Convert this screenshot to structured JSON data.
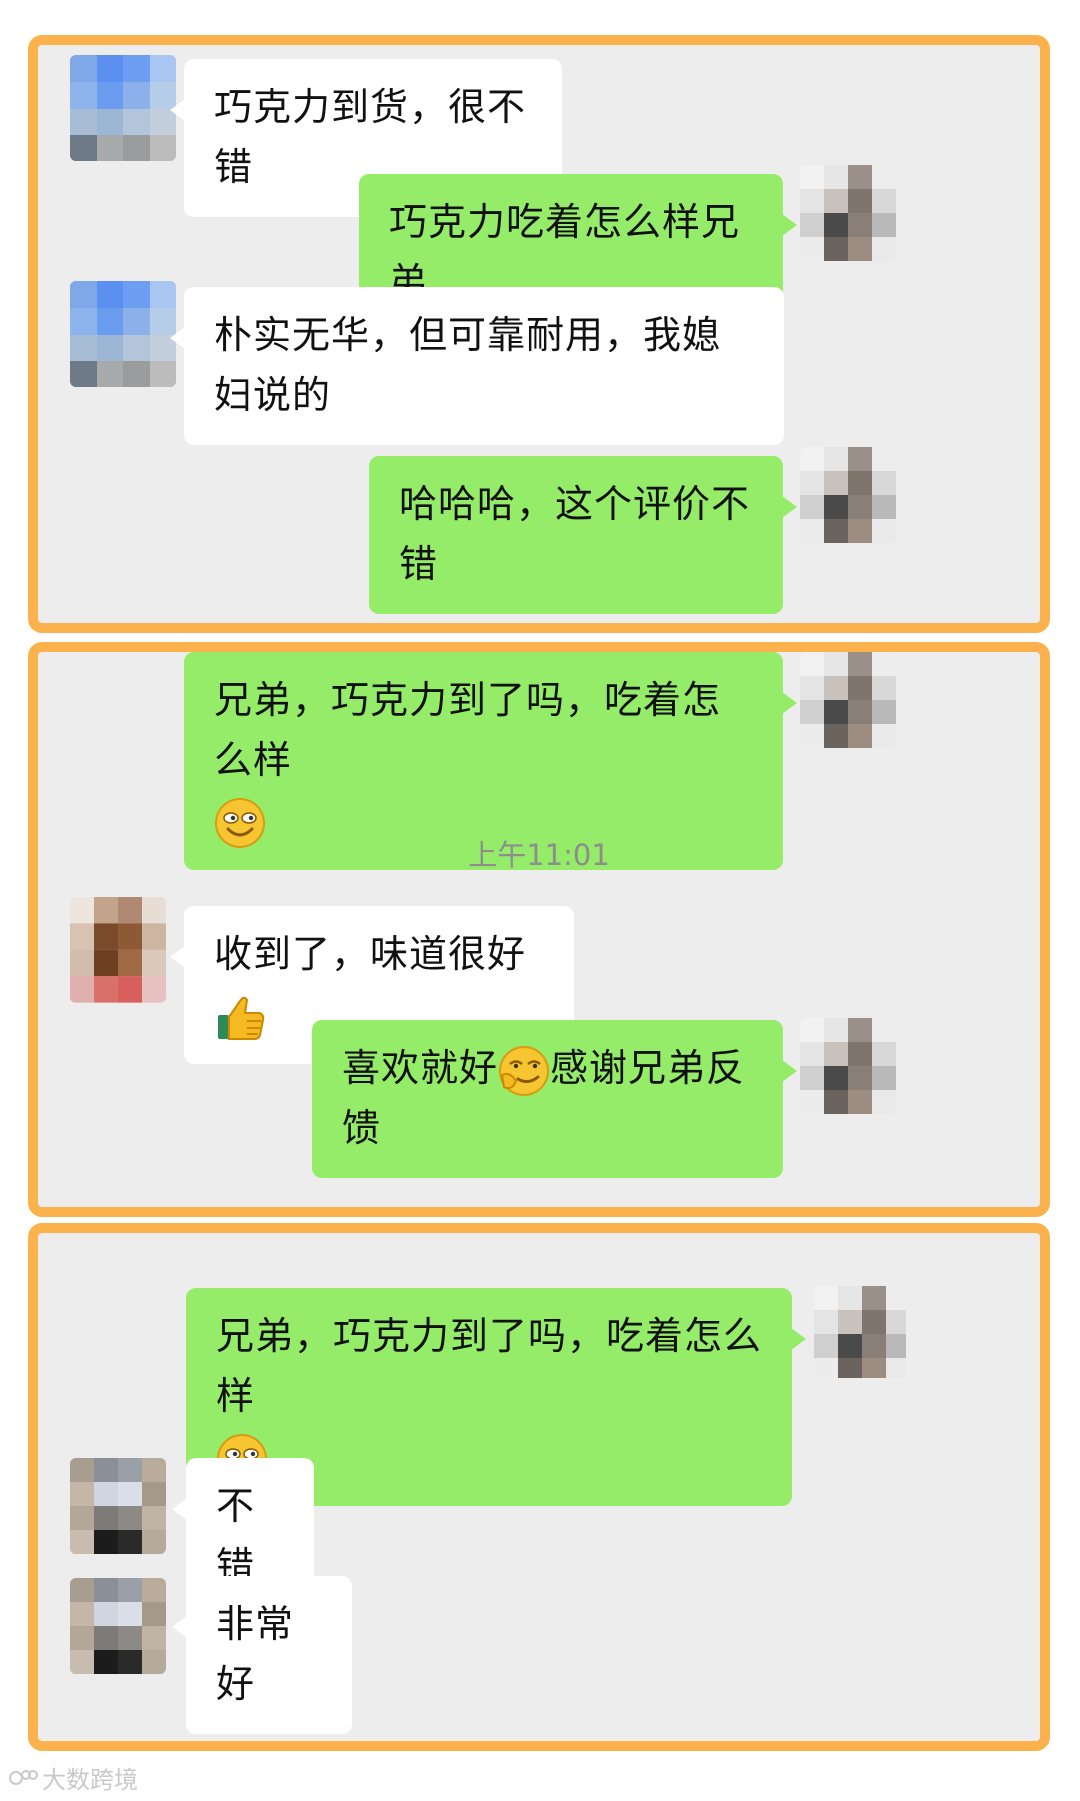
{
  "panel1": {
    "messages": [
      {
        "side": "in",
        "text": "巧克力到货，很不错"
      },
      {
        "side": "out",
        "text": "巧克力吃着怎么样兄弟"
      },
      {
        "side": "in",
        "text": "朴实无华，但可靠耐用，我媳妇说的"
      },
      {
        "side": "out",
        "text": "哈哈哈，这个评价不错"
      }
    ]
  },
  "panel2": {
    "messages": [
      {
        "side": "out",
        "text": "兄弟，巧克力到了吗，吃着怎么样",
        "emoji": "smile-emoji"
      },
      {
        "side": "in",
        "text": "收到了，味道很好",
        "emoji": "thumbs-up-emoji"
      },
      {
        "side": "out",
        "text_before": "喜欢就好",
        "emoji": "smirk-emoji",
        "text_after": "感谢兄弟反馈"
      }
    ],
    "timestamp": "上午11:01"
  },
  "panel3": {
    "messages": [
      {
        "side": "out",
        "text": "兄弟，巧克力到了吗，吃着怎么样",
        "emoji": "smile-emoji"
      },
      {
        "side": "in",
        "text": "不错"
      },
      {
        "side": "in",
        "text": "非常好"
      }
    ]
  },
  "watermark": {
    "text": "大数跨境"
  },
  "colors": {
    "panel_border": "#fbb24c",
    "panel_bg": "#ededed",
    "out_bubble": "#95ec69",
    "in_bubble": "#ffffff"
  }
}
